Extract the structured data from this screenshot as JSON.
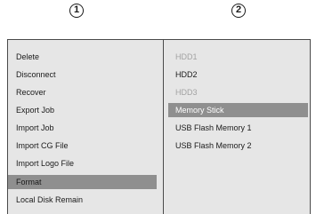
{
  "callouts": {
    "left": "1",
    "right": "2"
  },
  "menu": {
    "column1": [
      {
        "label": "Delete",
        "selected": false
      },
      {
        "label": "Disconnect",
        "selected": false
      },
      {
        "label": "Recover",
        "selected": false
      },
      {
        "label": "Export Job",
        "selected": false
      },
      {
        "label": "Import Job",
        "selected": false
      },
      {
        "label": "Import CG File",
        "selected": false
      },
      {
        "label": "Import Logo File",
        "selected": false
      },
      {
        "label": "Format",
        "selected": true
      },
      {
        "label": "Local Disk Remain",
        "selected": false
      }
    ],
    "column2": [
      {
        "label": "HDD1",
        "disabled": true
      },
      {
        "label": "HDD2",
        "disabled": false
      },
      {
        "label": "HDD3",
        "disabled": true
      },
      {
        "label": "Memory Stick",
        "selected": true
      },
      {
        "label": "USB Flash Memory 1",
        "disabled": false
      },
      {
        "label": "USB Flash Memory 2",
        "disabled": false
      }
    ]
  },
  "colors": {
    "menu_background": "#e6e6e6",
    "selection_highlight": "#8f8f8f",
    "disabled_text": "#a2a2a2",
    "border": "#4a4a4a"
  }
}
